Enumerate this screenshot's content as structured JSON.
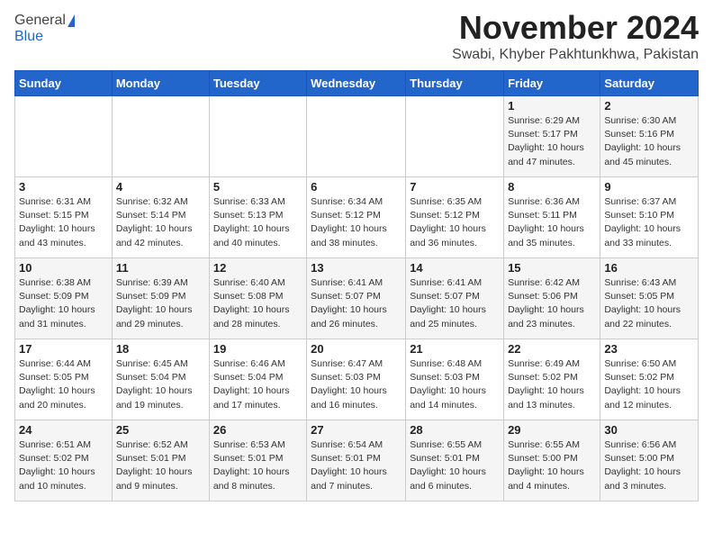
{
  "header": {
    "logo_general": "General",
    "logo_blue": "Blue",
    "month": "November 2024",
    "location": "Swabi, Khyber Pakhtunkhwa, Pakistan"
  },
  "weekdays": [
    "Sunday",
    "Monday",
    "Tuesday",
    "Wednesday",
    "Thursday",
    "Friday",
    "Saturday"
  ],
  "weeks": [
    [
      {
        "day": "",
        "info": ""
      },
      {
        "day": "",
        "info": ""
      },
      {
        "day": "",
        "info": ""
      },
      {
        "day": "",
        "info": ""
      },
      {
        "day": "",
        "info": ""
      },
      {
        "day": "1",
        "info": "Sunrise: 6:29 AM\nSunset: 5:17 PM\nDaylight: 10 hours and 47 minutes."
      },
      {
        "day": "2",
        "info": "Sunrise: 6:30 AM\nSunset: 5:16 PM\nDaylight: 10 hours and 45 minutes."
      }
    ],
    [
      {
        "day": "3",
        "info": "Sunrise: 6:31 AM\nSunset: 5:15 PM\nDaylight: 10 hours and 43 minutes."
      },
      {
        "day": "4",
        "info": "Sunrise: 6:32 AM\nSunset: 5:14 PM\nDaylight: 10 hours and 42 minutes."
      },
      {
        "day": "5",
        "info": "Sunrise: 6:33 AM\nSunset: 5:13 PM\nDaylight: 10 hours and 40 minutes."
      },
      {
        "day": "6",
        "info": "Sunrise: 6:34 AM\nSunset: 5:12 PM\nDaylight: 10 hours and 38 minutes."
      },
      {
        "day": "7",
        "info": "Sunrise: 6:35 AM\nSunset: 5:12 PM\nDaylight: 10 hours and 36 minutes."
      },
      {
        "day": "8",
        "info": "Sunrise: 6:36 AM\nSunset: 5:11 PM\nDaylight: 10 hours and 35 minutes."
      },
      {
        "day": "9",
        "info": "Sunrise: 6:37 AM\nSunset: 5:10 PM\nDaylight: 10 hours and 33 minutes."
      }
    ],
    [
      {
        "day": "10",
        "info": "Sunrise: 6:38 AM\nSunset: 5:09 PM\nDaylight: 10 hours and 31 minutes."
      },
      {
        "day": "11",
        "info": "Sunrise: 6:39 AM\nSunset: 5:09 PM\nDaylight: 10 hours and 29 minutes."
      },
      {
        "day": "12",
        "info": "Sunrise: 6:40 AM\nSunset: 5:08 PM\nDaylight: 10 hours and 28 minutes."
      },
      {
        "day": "13",
        "info": "Sunrise: 6:41 AM\nSunset: 5:07 PM\nDaylight: 10 hours and 26 minutes."
      },
      {
        "day": "14",
        "info": "Sunrise: 6:41 AM\nSunset: 5:07 PM\nDaylight: 10 hours and 25 minutes."
      },
      {
        "day": "15",
        "info": "Sunrise: 6:42 AM\nSunset: 5:06 PM\nDaylight: 10 hours and 23 minutes."
      },
      {
        "day": "16",
        "info": "Sunrise: 6:43 AM\nSunset: 5:05 PM\nDaylight: 10 hours and 22 minutes."
      }
    ],
    [
      {
        "day": "17",
        "info": "Sunrise: 6:44 AM\nSunset: 5:05 PM\nDaylight: 10 hours and 20 minutes."
      },
      {
        "day": "18",
        "info": "Sunrise: 6:45 AM\nSunset: 5:04 PM\nDaylight: 10 hours and 19 minutes."
      },
      {
        "day": "19",
        "info": "Sunrise: 6:46 AM\nSunset: 5:04 PM\nDaylight: 10 hours and 17 minutes."
      },
      {
        "day": "20",
        "info": "Sunrise: 6:47 AM\nSunset: 5:03 PM\nDaylight: 10 hours and 16 minutes."
      },
      {
        "day": "21",
        "info": "Sunrise: 6:48 AM\nSunset: 5:03 PM\nDaylight: 10 hours and 14 minutes."
      },
      {
        "day": "22",
        "info": "Sunrise: 6:49 AM\nSunset: 5:02 PM\nDaylight: 10 hours and 13 minutes."
      },
      {
        "day": "23",
        "info": "Sunrise: 6:50 AM\nSunset: 5:02 PM\nDaylight: 10 hours and 12 minutes."
      }
    ],
    [
      {
        "day": "24",
        "info": "Sunrise: 6:51 AM\nSunset: 5:02 PM\nDaylight: 10 hours and 10 minutes."
      },
      {
        "day": "25",
        "info": "Sunrise: 6:52 AM\nSunset: 5:01 PM\nDaylight: 10 hours and 9 minutes."
      },
      {
        "day": "26",
        "info": "Sunrise: 6:53 AM\nSunset: 5:01 PM\nDaylight: 10 hours and 8 minutes."
      },
      {
        "day": "27",
        "info": "Sunrise: 6:54 AM\nSunset: 5:01 PM\nDaylight: 10 hours and 7 minutes."
      },
      {
        "day": "28",
        "info": "Sunrise: 6:55 AM\nSunset: 5:01 PM\nDaylight: 10 hours and 6 minutes."
      },
      {
        "day": "29",
        "info": "Sunrise: 6:55 AM\nSunset: 5:00 PM\nDaylight: 10 hours and 4 minutes."
      },
      {
        "day": "30",
        "info": "Sunrise: 6:56 AM\nSunset: 5:00 PM\nDaylight: 10 hours and 3 minutes."
      }
    ]
  ]
}
